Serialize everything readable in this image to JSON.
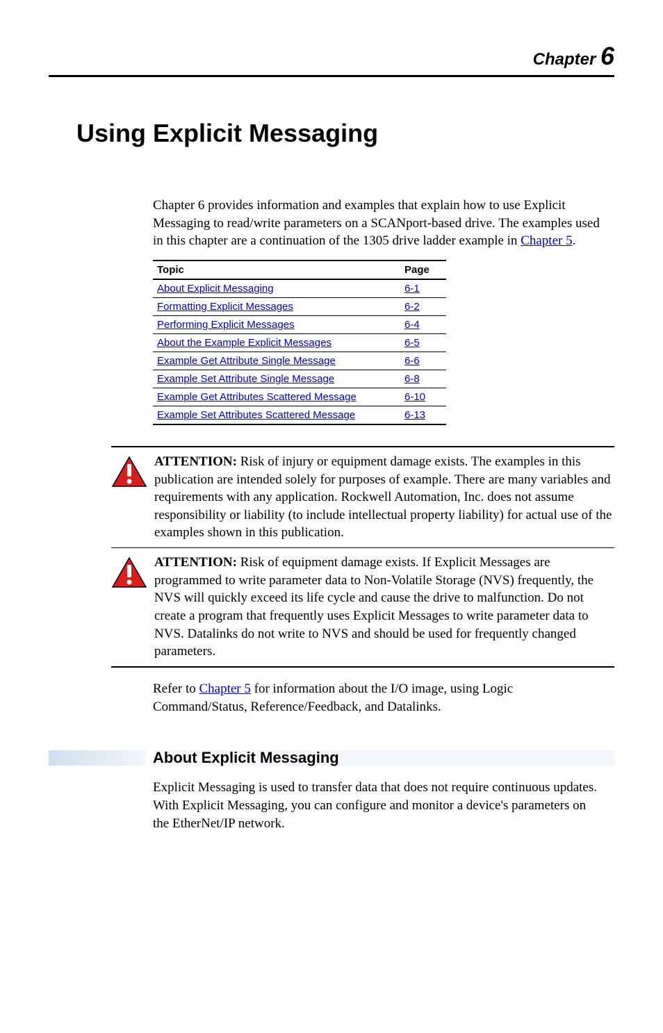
{
  "chapter": {
    "label": "Chapter",
    "number": "6"
  },
  "title": "Using Explicit Messaging",
  "intro": {
    "text_before_link": "Chapter 6 provides information and examples that explain how to use Explicit Messaging to read/write parameters on a SCANport-based drive. The examples used in this chapter are a continuation of the 1305 drive ladder example in ",
    "link_text": "Chapter 5",
    "text_after_link": "."
  },
  "topic_table": {
    "headers": {
      "topic": "Topic",
      "page": "Page"
    },
    "rows": [
      {
        "topic": "About Explicit Messaging",
        "page": "6-1"
      },
      {
        "topic": "Formatting Explicit Messages",
        "page": "6-2"
      },
      {
        "topic": "Performing Explicit Messages",
        "page": "6-4"
      },
      {
        "topic": "About the Example Explicit Messages",
        "page": "6-5"
      },
      {
        "topic": "Example Get Attribute Single Message",
        "page": "6-6"
      },
      {
        "topic": "Example Set Attribute Single Message",
        "page": "6-8"
      },
      {
        "topic": "Example Get Attributes Scattered Message",
        "page": "6-10"
      },
      {
        "topic": "Example Set Attributes Scattered Message",
        "page": "6-13"
      }
    ]
  },
  "attentions": [
    {
      "label": "ATTENTION:",
      "text": "  Risk of injury or equipment damage exists. The examples in this publication are intended solely for purposes of example. There are many variables and requirements with any application. Rockwell Automation, Inc. does not assume responsibility or liability (to include intellectual property liability) for actual use of the examples shown in this publication."
    },
    {
      "label": "ATTENTION:",
      "text": "  Risk of equipment damage exists. If Explicit Messages are programmed to write parameter data to Non-Volatile Storage (NVS) frequently, the NVS will quickly exceed its life cycle and cause the drive to malfunction. Do not create a program that frequently uses Explicit Messages to write parameter data to NVS. Datalinks do not write to NVS and should be used for frequently changed parameters."
    }
  ],
  "post_attention": {
    "before": "Refer to ",
    "link": "Chapter 5",
    "after": " for information about the I/O image, using Logic Command/Status, Reference/Feedback, and Datalinks."
  },
  "section": {
    "heading": "About Explicit Messaging",
    "body": "Explicit Messaging is used to transfer data that does not require continuous updates. With Explicit Messaging, you can configure and monitor a device's parameters on the EtherNet/IP network."
  }
}
